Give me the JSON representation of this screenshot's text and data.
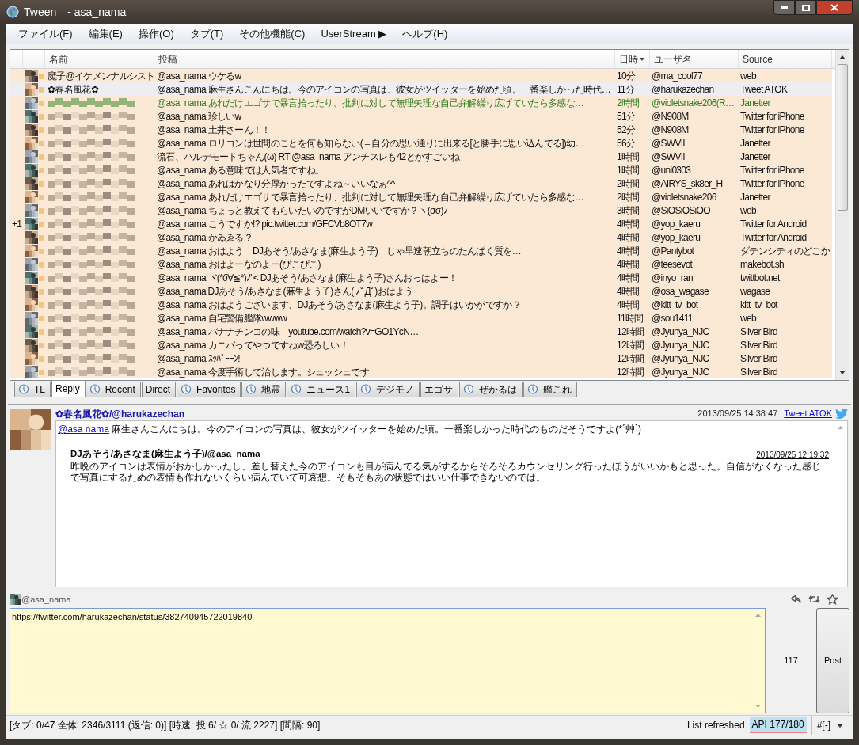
{
  "window": {
    "title": "Tween　- asa_nama"
  },
  "menu": [
    "ファイル(F)",
    "編集(E)",
    "操作(O)",
    "タブ(T)",
    "その他機能(C)",
    "UserStream ▶",
    "ヘルプ(H)"
  ],
  "table": {
    "columns": [
      {
        "label": "名前",
        "sorted": false
      },
      {
        "label": "投稿",
        "sorted": false
      },
      {
        "label": "日時",
        "sorted": true
      },
      {
        "label": "ユーザ名",
        "sorted": false
      },
      {
        "label": "Source",
        "sorted": false
      }
    ],
    "rows": [
      {
        "mark": "",
        "name": "魔子@イケメンナルシスト",
        "post": "@asa_nama ウケるw",
        "time": "10分",
        "user": "@ma_cool77",
        "source": "web",
        "selected": false
      },
      {
        "mark": "",
        "name": "✿春名風花✿",
        "post": "@asa_nama 麻生さんこんにちは。今のアイコンの写真は、彼女がツイッターを始めた頃。一番楽しかった時代…",
        "time": "11分",
        "user": "@harukazechan",
        "source": "Tweet ATOK",
        "selected": true
      },
      {
        "mark": "",
        "post": "@asa_nama あれだけエゴサで暴言拾ったり、批判に対して無理矢理な自己弁解繰り広げていたら多感な…",
        "time": "2時間",
        "user": "@violetsnake206(R…",
        "source": "Janetter",
        "selected": false,
        "color": "#2f7d20"
      },
      {
        "mark": "",
        "post": "@asa_nama 珍しいw",
        "time": "51分",
        "user": "@N908M",
        "source": "Twitter for iPhone",
        "selected": false
      },
      {
        "mark": "",
        "post": "@asa_nama 土井さーん！！",
        "time": "52分",
        "user": "@N908M",
        "source": "Twitter for iPhone",
        "selected": false
      },
      {
        "mark": "",
        "post": "@asa_nama ロリコンは世間のことを何も知らない(＝自分の思い通りに出来る[と勝手に思い込んでる])幼…",
        "time": "56分",
        "user": "@SWVII",
        "source": "Janetter",
        "selected": false
      },
      {
        "mark": "",
        "post": "流石、ハルデモートちゃん(ω) RT @asa_nama アンチスレも42とかすごいね",
        "time": "1時間",
        "user": "@SWVII",
        "source": "Janetter",
        "selected": false
      },
      {
        "mark": "",
        "post": "@asa_nama ある意味では人気者ですね。",
        "time": "1時間",
        "user": "@uni0303",
        "source": "Twitter for iPhone",
        "selected": false
      },
      {
        "mark": "",
        "post": "@asa_nama あれはかなり分厚かったですよね～いいなぁ^^",
        "time": "2時間",
        "user": "@AIRYS_sk8er_H",
        "source": "Twitter for iPhone",
        "selected": false
      },
      {
        "mark": "",
        "post": "@asa_nama あれだけエゴサで暴言拾ったり、批判に対して無理矢理な自己弁解繰り広げていたら多感な…",
        "time": "2時間",
        "user": "@violetsnake206",
        "source": "Janetter",
        "selected": false
      },
      {
        "mark": "",
        "post": "@asa_nama ちょっと教えてもらいたいのですがDMいいですか？ヽ(σσ)ﾉ",
        "time": "3時間",
        "user": "@SiOSiOSiOO",
        "source": "web",
        "selected": false
      },
      {
        "mark": "+1",
        "post": "@asa_nama こうですか!? pic.twitter.com/GFCVb8OT7w",
        "time": "4時間",
        "user": "@yop_kaeru",
        "source": "Twitter for Android",
        "selected": false
      },
      {
        "mark": "",
        "post": "@asa_nama かゐゑる？",
        "time": "4時間",
        "user": "@yop_kaeru",
        "source": "Twitter for Android",
        "selected": false
      },
      {
        "mark": "",
        "post": "@asa_nama おはよう　DJあそう/あさなま(麻生よう子)　じゃ早速朝立ちのたんぱく質を…",
        "time": "4時間",
        "user": "@Pantybot",
        "source": "ダテンシティのどこか",
        "selected": false
      },
      {
        "mark": "",
        "post": "@asa_nama おはよーなのよー(ぴこぴこ)",
        "time": "4時間",
        "user": "@teesevot",
        "source": "makebot.sh",
        "selected": false
      },
      {
        "mark": "",
        "post": "@asa_nama ヾ(*ő∀≦*)ﾉ\"< DJあそう/あさなま(麻生よう子)さんおっはよー！",
        "time": "4時間",
        "user": "@inyo_ran",
        "source": "twittbot.net",
        "selected": false
      },
      {
        "mark": "",
        "post": "@asa_nama DJあそう/あさなま(麻生よう子)さん( ﾉﾟДﾟ)おはよう",
        "time": "4時間",
        "user": "@osa_wagase",
        "source": "wagase",
        "selected": false
      },
      {
        "mark": "",
        "post": "@asa_nama おはようございます、DJあそう/あさなま(麻生よう子)。調子はいかがですか？",
        "time": "4時間",
        "user": "@kitt_tv_bot",
        "source": "kitt_tv_bot",
        "selected": false
      },
      {
        "mark": "",
        "post": "@asa_nama 自宅警備艦隊wwww",
        "time": "11時間",
        "user": "@sou1411",
        "source": "web",
        "selected": false
      },
      {
        "mark": "",
        "post": "@asa_nama バナナチンコの味　youtube.com/watch?v=GO1YcN…",
        "time": "12時間",
        "user": "@Jyunya_NJC",
        "source": "Silver Bird",
        "selected": false
      },
      {
        "mark": "",
        "post": "@asa_nama カニバってやつですねw恐ろしい！",
        "time": "12時間",
        "user": "@Jyunya_NJC",
        "source": "Silver Bird",
        "selected": false
      },
      {
        "mark": "",
        "post": "@asa_nama ｽｯﾊﾟｰｰﾝ!",
        "time": "12時間",
        "user": "@Jyunya_NJC",
        "source": "Silver Bird",
        "selected": false
      },
      {
        "mark": "",
        "post": "@asa_nama 今度手術して治します。シュッシュです",
        "time": "12時間",
        "user": "@Jyunya_NJC",
        "source": "Silver Bird",
        "selected": false
      }
    ]
  },
  "tabs": [
    {
      "label": "TL",
      "icon": true,
      "selected": false
    },
    {
      "label": "Reply",
      "icon": false,
      "selected": true
    },
    {
      "label": "Recent",
      "icon": true,
      "selected": false
    },
    {
      "label": "Direct",
      "icon": false,
      "selected": false
    },
    {
      "label": "Favorites",
      "icon": true,
      "selected": false
    },
    {
      "label": "地震",
      "icon": true,
      "selected": false
    },
    {
      "label": "ニュース1",
      "icon": true,
      "selected": false
    },
    {
      "label": "デジモノ",
      "icon": true,
      "selected": false
    },
    {
      "label": "エゴサ",
      "icon": false,
      "selected": false
    },
    {
      "label": "ぜかるは",
      "icon": true,
      "selected": false
    },
    {
      "label": "艦これ",
      "icon": true,
      "selected": false
    }
  ],
  "detail": {
    "author": "✿春名風花✿/@harukazechan",
    "date": "2013/09/25 14:38:47",
    "source": "Tweet ATOK",
    "mention": "@asa nama",
    "text": " 麻生さんこんにちは。今のアイコンの写真は、彼女がツイッターを始めた頃。一番楽しかった時代のものだそうですよ(*´艸`)",
    "quote": {
      "author": "DJあそう/あさなま(麻生よう子)/@asa_nama",
      "date": "2013/09/25 12:19:32",
      "text": "昨晩のアイコンは表情がおかしかったし、差し替えた今のアイコンも目が病んでる気がするからそろそろカウンセリング行ったほうがいいかもと思った。自信がなくなった感じで写真にするための表情も作れないくらい病んでいて可哀想。そもそもあの状態ではいい仕事できないのでは。"
    }
  },
  "compose": {
    "account": "@asa_nama",
    "value": "https://twitter.com/harukazechan/status/382740945722019840",
    "count": "117",
    "post": "Post"
  },
  "status_bar": {
    "info": "[タブ: 0/47 全体: 2346/3111 (返信: 0)] [時速: 投 6/ ☆ 0/ 流 2227] [間隔: 90]",
    "message": "List refreshed",
    "api": "API 177/180",
    "hash": "#[-]"
  }
}
